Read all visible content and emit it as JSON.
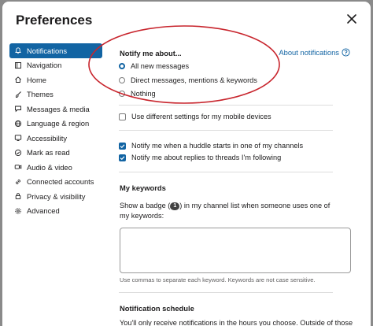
{
  "dialog": {
    "title": "Preferences",
    "close_label": "Close"
  },
  "sidebar": {
    "items": [
      {
        "label": "Notifications",
        "icon": "bell-icon",
        "active": true
      },
      {
        "label": "Navigation",
        "icon": "navigation-icon"
      },
      {
        "label": "Home",
        "icon": "home-icon"
      },
      {
        "label": "Themes",
        "icon": "brush-icon"
      },
      {
        "label": "Messages & media",
        "icon": "message-icon"
      },
      {
        "label": "Language & region",
        "icon": "globe-icon"
      },
      {
        "label": "Accessibility",
        "icon": "accessibility-icon"
      },
      {
        "label": "Mark as read",
        "icon": "check-circle-icon"
      },
      {
        "label": "Audio & video",
        "icon": "video-icon"
      },
      {
        "label": "Connected accounts",
        "icon": "link-icon"
      },
      {
        "label": "Privacy & visibility",
        "icon": "lock-icon"
      },
      {
        "label": "Advanced",
        "icon": "gear-icon"
      }
    ]
  },
  "notify": {
    "heading": "Notify me about...",
    "about_link": "About notifications",
    "options": [
      {
        "label": "All new messages",
        "selected": true
      },
      {
        "label": "Direct messages, mentions & keywords",
        "selected": false
      },
      {
        "label": "Nothing",
        "selected": false
      }
    ],
    "mobile_checkbox": {
      "label": "Use different settings for my mobile devices",
      "checked": false
    },
    "huddle_checkbox": {
      "label": "Notify me when a huddle starts in one of my channels",
      "checked": true
    },
    "threads_checkbox": {
      "label": "Notify me about replies to threads I'm following",
      "checked": true
    }
  },
  "keywords": {
    "heading": "My keywords",
    "desc_before": "Show a badge (",
    "badge": "1",
    "desc_after": ") in my channel list when someone uses one of my keywords:",
    "input_value": "",
    "hint": "Use commas to separate each keyword. Keywords are not case sensitive."
  },
  "schedule": {
    "heading": "Notification schedule",
    "text": "You'll only receive notifications in the hours you choose. Outside of those"
  },
  "colors": {
    "accent": "#1264a3",
    "annotation": "#c8252d"
  }
}
